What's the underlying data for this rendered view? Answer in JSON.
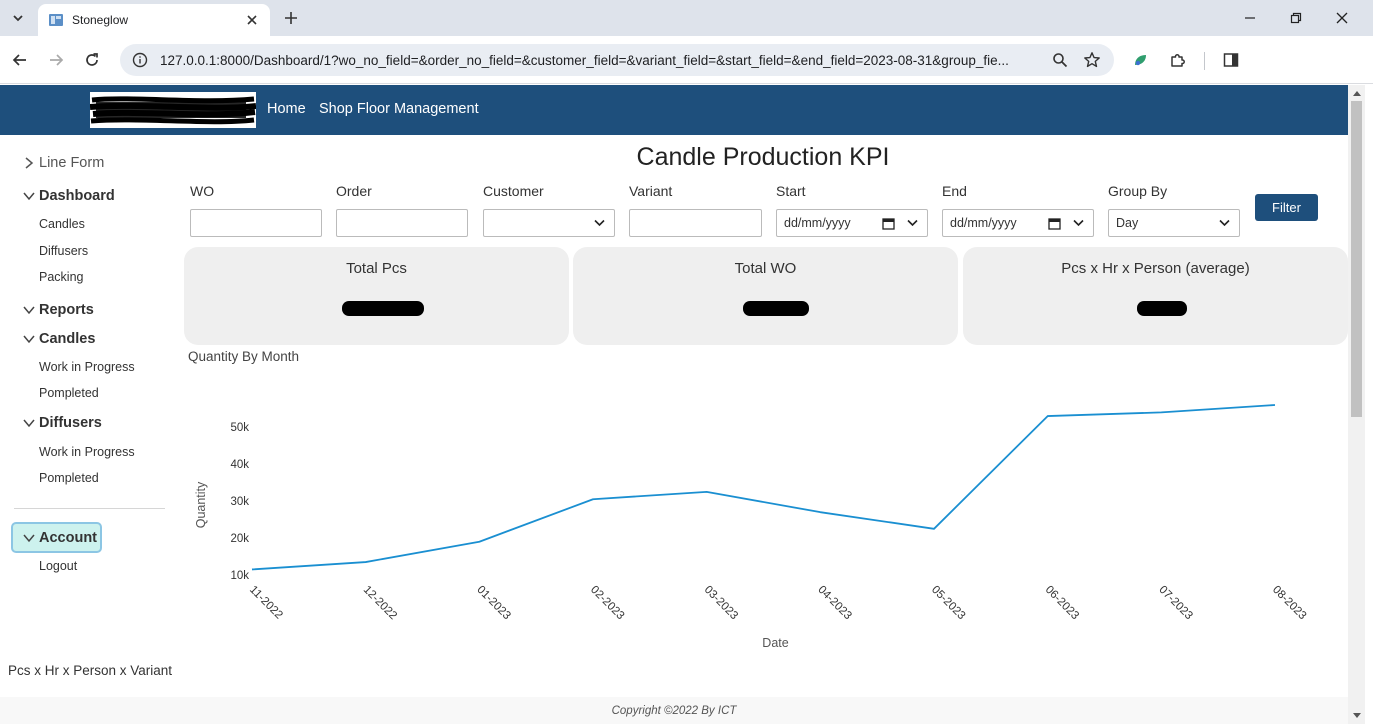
{
  "browser": {
    "tab_title": "Stoneglow",
    "url": "127.0.0.1:8000/Dashboard/1?wo_no_field=&order_no_field=&customer_field=&variant_field=&start_field=&end_field=2023-08-31&group_fie..."
  },
  "navbar": {
    "links": [
      "Home",
      "Shop Floor Management"
    ],
    "color": "#1e4f7c"
  },
  "sidebar": {
    "line_form": "Line Form",
    "dashboard": {
      "label": "Dashboard",
      "items": [
        "Candles",
        "Diffusers",
        "Packing"
      ]
    },
    "reports": "Reports",
    "candles": {
      "label": "Candles",
      "items": [
        "Work in Progress",
        "Pompleted"
      ]
    },
    "diffusers": {
      "label": "Diffusers",
      "items": [
        "Work in Progress",
        "Pompleted"
      ]
    },
    "account": {
      "label": "Account",
      "items": [
        "Logout"
      ]
    }
  },
  "main": {
    "title": "Candle Production KPI",
    "filters": {
      "wo": {
        "label": "WO",
        "value": ""
      },
      "order": {
        "label": "Order",
        "value": ""
      },
      "customer": {
        "label": "Customer",
        "value": ""
      },
      "variant": {
        "label": "Variant",
        "value": ""
      },
      "start": {
        "label": "Start",
        "placeholder": "dd/mm/yyyy"
      },
      "end": {
        "label": "End",
        "placeholder": "dd/mm/yyyy"
      },
      "group_by": {
        "label": "Group By",
        "value": "Day"
      },
      "button": "Filter"
    },
    "kpis": [
      {
        "title": "Total Pcs",
        "value": ""
      },
      {
        "title": "Total WO",
        "value": ""
      },
      {
        "title": "Pcs x Hr x Person (average)",
        "value": ""
      }
    ],
    "chart_title": "Quantity By Month",
    "bottom_label": "Pcs x Hr x Person x Variant"
  },
  "footer": "Copyright ©2022 By ICT",
  "chart_data": {
    "type": "line",
    "categories": [
      "11-2022",
      "12-2022",
      "01-2023",
      "02-2023",
      "03-2023",
      "04-2023",
      "05-2023",
      "06-2023",
      "07-2023",
      "08-2023"
    ],
    "series": [
      {
        "values": [
          11500,
          13500,
          19000,
          30500,
          32500,
          27000,
          22500,
          53000,
          54000,
          56000
        ],
        "color": "#1a8fd1"
      }
    ],
    "xlabel": "Date",
    "ylabel": "Quantity",
    "yticks": [
      10000,
      20000,
      30000,
      40000,
      50000
    ],
    "ytick_labels": [
      "10k",
      "20k",
      "30k",
      "40k",
      "50k"
    ],
    "ylim": [
      10000,
      56000
    ],
    "grid": false
  }
}
